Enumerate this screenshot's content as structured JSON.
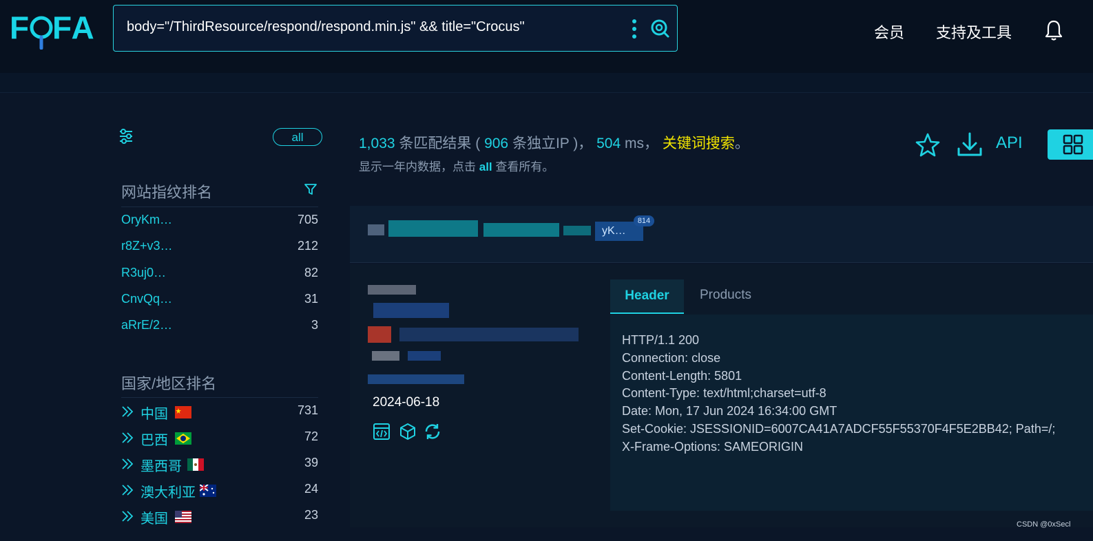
{
  "app": {
    "logo": "FOFA"
  },
  "search": {
    "query": "body=\"/ThirdResource/respond/respond.min.js\" && title=\"Crocus\""
  },
  "nav": {
    "vip": "会员",
    "tools": "支持及工具"
  },
  "sidebar": {
    "pill_all": "all",
    "fingerprint_title": "网站指纹排名",
    "fingerprints": [
      {
        "label": "OryKm…",
        "count": "705"
      },
      {
        "label": "r8Z+v3…",
        "count": "212"
      },
      {
        "label": "R3uj0…",
        "count": "82"
      },
      {
        "label": "CnvQq…",
        "count": "31"
      },
      {
        "label": "aRrE/2…",
        "count": "3"
      }
    ],
    "country_title": "国家/地区排名",
    "countries": [
      {
        "label": "中国",
        "count": "731",
        "flag": "cn"
      },
      {
        "label": "巴西",
        "count": "72",
        "flag": "br"
      },
      {
        "label": "墨西哥",
        "count": "39",
        "flag": "mx"
      },
      {
        "label": "澳大利亚",
        "count": "24",
        "flag": "au"
      },
      {
        "label": "美国",
        "count": "23",
        "flag": "us"
      }
    ]
  },
  "results": {
    "count": "1,033",
    "count_suffix": "条匹配结果 (",
    "unique_ip": "906",
    "unique_ip_suffix": "条独立IP )，",
    "ms": "504",
    "ms_suffix": "ms，",
    "keyword_search": "关键词搜索",
    "period": "。",
    "sub_prefix": "显示一年内数据，点击",
    "sub_all": "all",
    "sub_suffix": "查看所有。",
    "api": "API"
  },
  "card": {
    "host_badge": "yK…",
    "host_badge_count": "814",
    "date": "2024-06-18",
    "tabs": {
      "header": "Header",
      "products": "Products"
    },
    "header_lines": [
      "HTTP/1.1 200",
      "Connection: close",
      "Content-Length: 5801",
      "Content-Type: text/html;charset=utf-8",
      "Date: Mon, 17 Jun 2024 16:34:00 GMT",
      "Set-Cookie: JSESSIONID=6007CA41A7ADCF55F55370F4F5E2BB42; Path=/;",
      "X-Frame-Options: SAMEORIGIN"
    ]
  },
  "watermark": "CSDN @0xSecl",
  "colors": {
    "accent": "#1fd2e2",
    "keyword": "#f2e500",
    "background": "#0b1628"
  }
}
